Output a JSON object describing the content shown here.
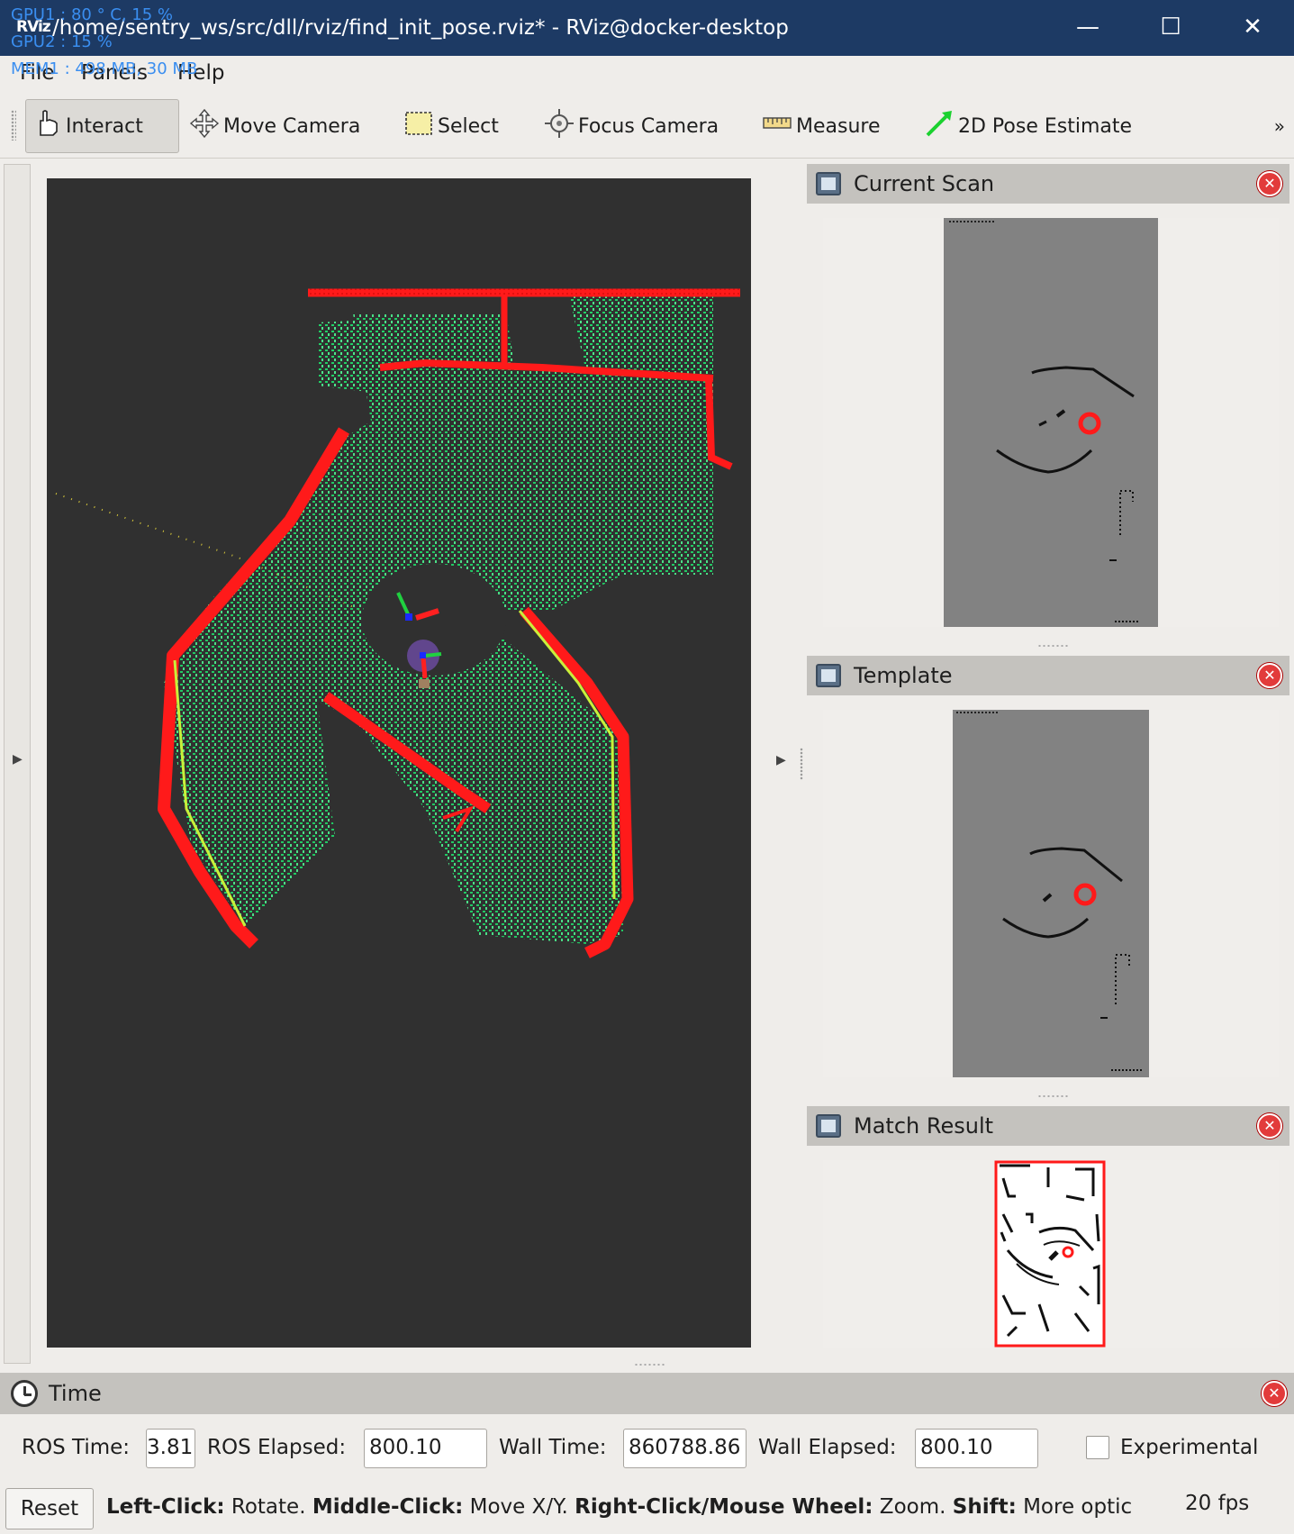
{
  "window": {
    "app_icon": "RViz",
    "title": "/home/sentry_ws/src/dll/rviz/find_init_pose.rviz* - RViz@docker-desktop",
    "minimize": "—",
    "maximize": "☐",
    "close": "✕"
  },
  "overlay": {
    "gpu1": "GPU1  : 80 ° C, 15 %",
    "gpu2": "GPU2  : 15 %",
    "mem": "MEM1 : 498 MB, 30 MB"
  },
  "menu": [
    "File",
    "Panels",
    "Help"
  ],
  "toolbar": {
    "tools": [
      {
        "label": "Interact",
        "icon": "hand-pointer-icon",
        "active": true
      },
      {
        "label": "Move Camera",
        "icon": "move-arrows-icon",
        "active": false
      },
      {
        "label": "Select",
        "icon": "select-box-icon",
        "active": false
      },
      {
        "label": "Focus Camera",
        "icon": "crosshair-icon",
        "active": false
      },
      {
        "label": "Measure",
        "icon": "ruler-icon",
        "active": false
      },
      {
        "label": "2D Pose Estimate",
        "icon": "green-arrow-icon",
        "active": false
      }
    ],
    "overflow": "»"
  },
  "panels": {
    "current_scan": {
      "title": "Current Scan"
    },
    "template": {
      "title": "Template"
    },
    "match_result": {
      "title": "Match Result"
    }
  },
  "time": {
    "title": "Time",
    "ros_time_label": "ROS Time:",
    "ros_time_value": "3.81",
    "ros_elapsed_label": "ROS Elapsed:",
    "ros_elapsed_value": "800.10",
    "wall_time_label": "Wall Time:",
    "wall_time_value": "860788.86",
    "wall_elapsed_label": "Wall Elapsed:",
    "wall_elapsed_value": "800.10",
    "experimental_label": "Experimental"
  },
  "status": {
    "reset": "Reset",
    "left_click_key": "Left-Click:",
    "left_click_text": " Rotate. ",
    "middle_click_key": "Middle-Click:",
    "middle_click_text": " Move X/Y. ",
    "right_click_key": "Right-Click/Mouse Wheel:",
    "right_click_text": " Zoom. ",
    "shift_key": "Shift:",
    "shift_text": " More optic",
    "fps": "20 fps"
  },
  "colors": {
    "titlebar": "#1d3a64",
    "render_bg": "#303030",
    "scan_green": "#2bd96b",
    "scan_red": "#ff1a1a"
  }
}
